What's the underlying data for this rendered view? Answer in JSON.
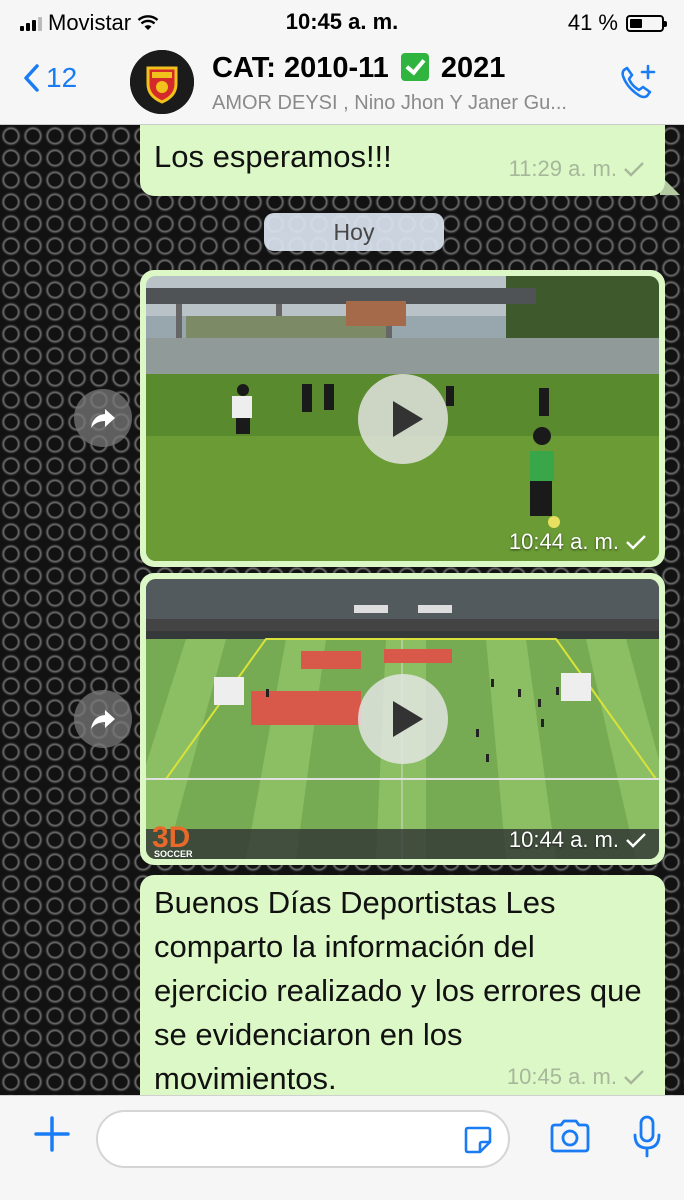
{
  "status": {
    "carrier": "Movistar",
    "time": "10:45 a. m.",
    "battery_pct": "41 %",
    "battery_level": 0.41
  },
  "header": {
    "back_count": "12",
    "title_pre": "CAT: 2010-11",
    "title_post": "2021",
    "subtitle": "AMOR DEYSI , Nino Jhon Y Janer Gu..."
  },
  "messages": [
    {
      "text": "Los esperamos!!!",
      "time": "11:29 a. m."
    },
    {
      "day": "Hoy"
    },
    {
      "type": "video",
      "time": "10:44 a. m."
    },
    {
      "type": "video",
      "time": "10:44 a. m.",
      "watermark": "3D SOCCER"
    },
    {
      "text": "Buenos Días Deportistas Les comparto la información del ejercicio realizado y los errores que se evidenciaron en los movimientos.",
      "time": "10:45 a. m."
    }
  ],
  "input": {
    "placeholder": ""
  },
  "colors": {
    "accent": "#1a7cf5",
    "bubble": "#dcf8c6"
  }
}
